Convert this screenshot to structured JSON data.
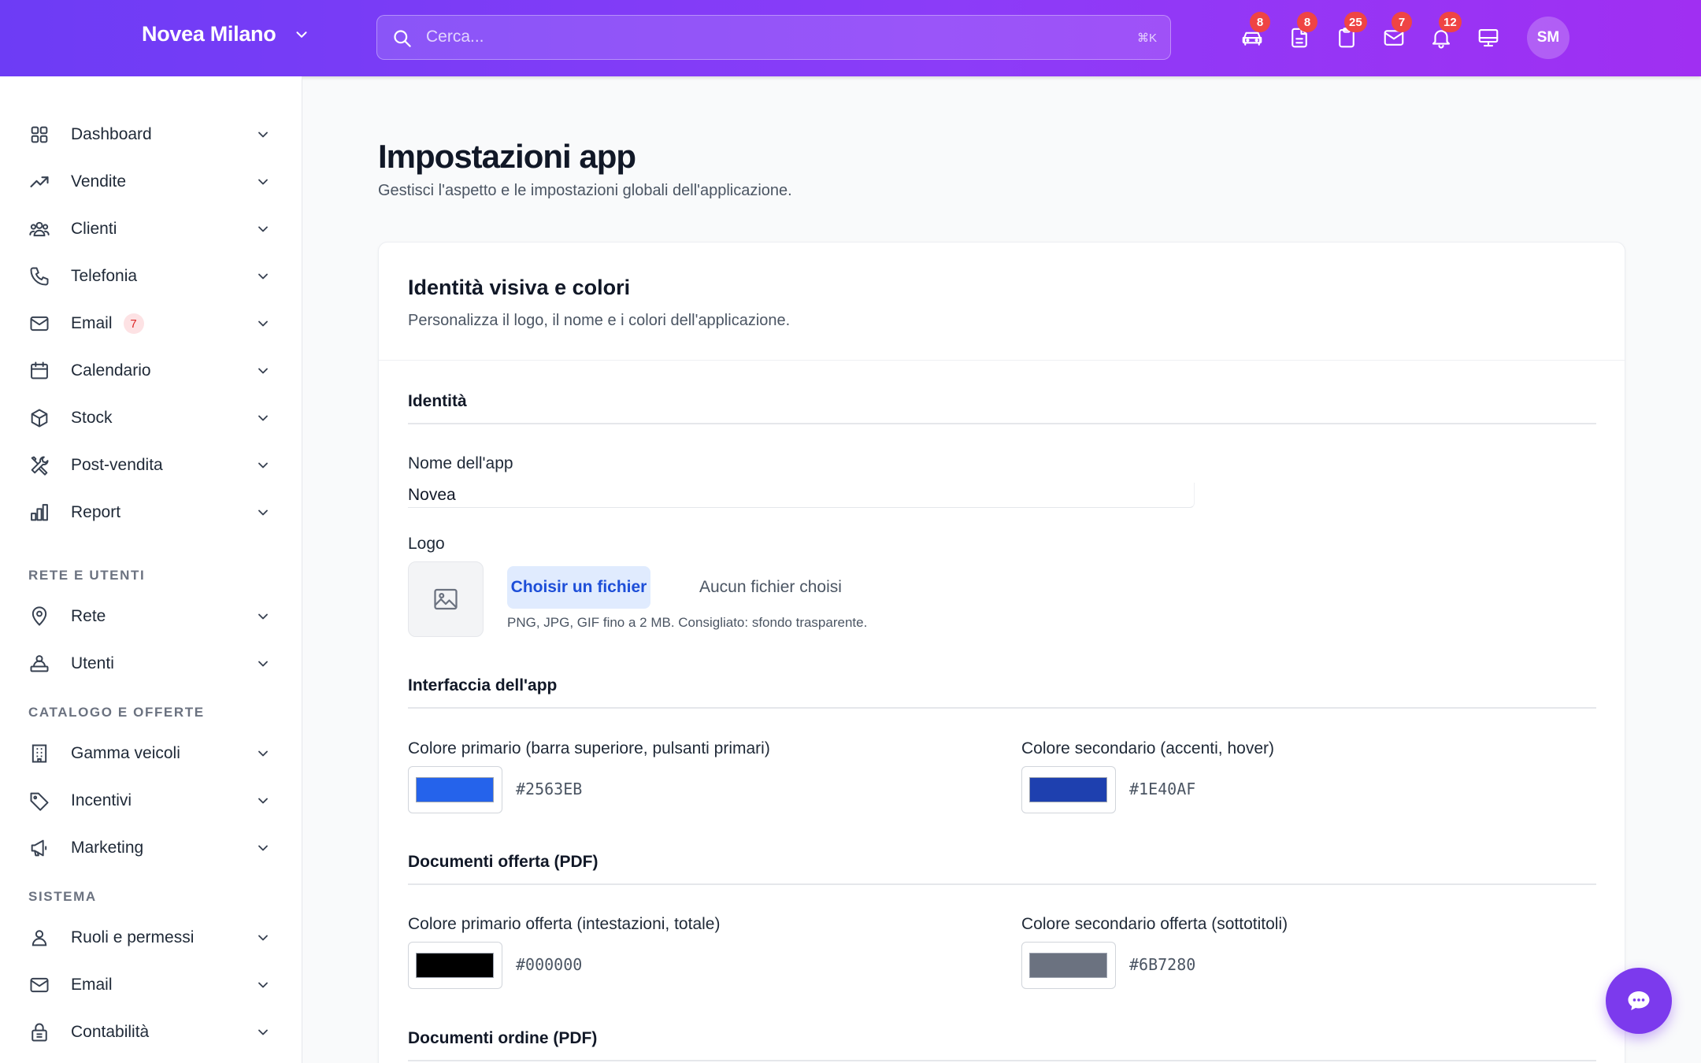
{
  "topbar": {
    "brand": "Novea Milano",
    "search_placeholder": "Cerca...",
    "search_shortcut": "⌘K",
    "icons": [
      {
        "name": "car-icon",
        "badge": "8"
      },
      {
        "name": "document-icon",
        "badge": "8"
      },
      {
        "name": "clipboard-icon",
        "badge": "25"
      },
      {
        "name": "mail-icon",
        "badge": "7"
      },
      {
        "name": "bell-icon",
        "badge": "12"
      },
      {
        "name": "monitor-icon",
        "badge": ""
      }
    ],
    "avatar": "SM",
    "gradient_colors": [
      "#6d3cf5",
      "#a02ff2"
    ]
  },
  "sidebar": {
    "main_items": [
      {
        "label": "Dashboard",
        "icon": "grid-icon"
      },
      {
        "label": "Vendite",
        "icon": "trending-up-icon"
      },
      {
        "label": "Clienti",
        "icon": "users-icon"
      },
      {
        "label": "Telefonia",
        "icon": "phone-icon"
      },
      {
        "label": "Email",
        "icon": "mail-icon",
        "badge": "7"
      },
      {
        "label": "Calendario",
        "icon": "calendar-icon"
      },
      {
        "label": "Stock",
        "icon": "box-icon"
      },
      {
        "label": "Post-vendita",
        "icon": "tools-icon"
      },
      {
        "label": "Report",
        "icon": "bar-chart-icon"
      }
    ],
    "section_rete": "RETE E UTENTI",
    "rete_items": [
      {
        "label": "Rete",
        "icon": "map-pin-icon"
      },
      {
        "label": "Utenti",
        "icon": "user-group-icon"
      }
    ],
    "section_catalogo": "CATALOGO E OFFERTE",
    "catalogo_items": [
      {
        "label": "Gamma veicoli",
        "icon": "building-icon"
      },
      {
        "label": "Incentivi",
        "icon": "tag-icon"
      },
      {
        "label": "Marketing",
        "icon": "megaphone-icon"
      }
    ],
    "section_sistema": "SISTEMA",
    "sistema_items": [
      {
        "label": "Ruoli e permessi",
        "icon": "user-icon"
      },
      {
        "label": "Email",
        "icon": "mail-icon"
      },
      {
        "label": "Contabilità",
        "icon": "lock-icon"
      }
    ]
  },
  "page": {
    "title": "Impostazioni app",
    "subtitle": "Gestisci l'aspetto e le impostazioni globali dell'applicazione."
  },
  "card": {
    "title": "Identità visiva e colori",
    "subtitle": "Personalizza il logo, il nome e i colori dell'applicazione.",
    "identity": {
      "section_title": "Identità",
      "app_name_label": "Nome dell'app",
      "app_name_value": "Novea",
      "logo_label": "Logo",
      "file_button": "Choisir un fichier",
      "file_none": "Aucun fichier choisi",
      "file_help": "PNG, JPG, GIF fino a 2 MB. Consigliato: sfondo trasparente."
    },
    "interface": {
      "section_title": "Interfaccia dell'app",
      "primary_label": "Colore primario (barra superiore, pulsanti primari)",
      "primary_value": "#2563EB",
      "secondary_label": "Colore secondario (accenti, hover)",
      "secondary_value": "#1E40AF"
    },
    "offer_docs": {
      "section_title": "Documenti offerta (PDF)",
      "primary_label": "Colore primario offerta (intestazioni, totale)",
      "primary_value": "#000000",
      "secondary_label": "Colore secondario offerta (sottotitoli)",
      "secondary_value": "#6B7280"
    },
    "order_docs": {
      "section_title": "Documenti ordine (PDF)"
    }
  },
  "chat_fab": {
    "icon": "chat-icon",
    "color": "#7c3aed"
  }
}
